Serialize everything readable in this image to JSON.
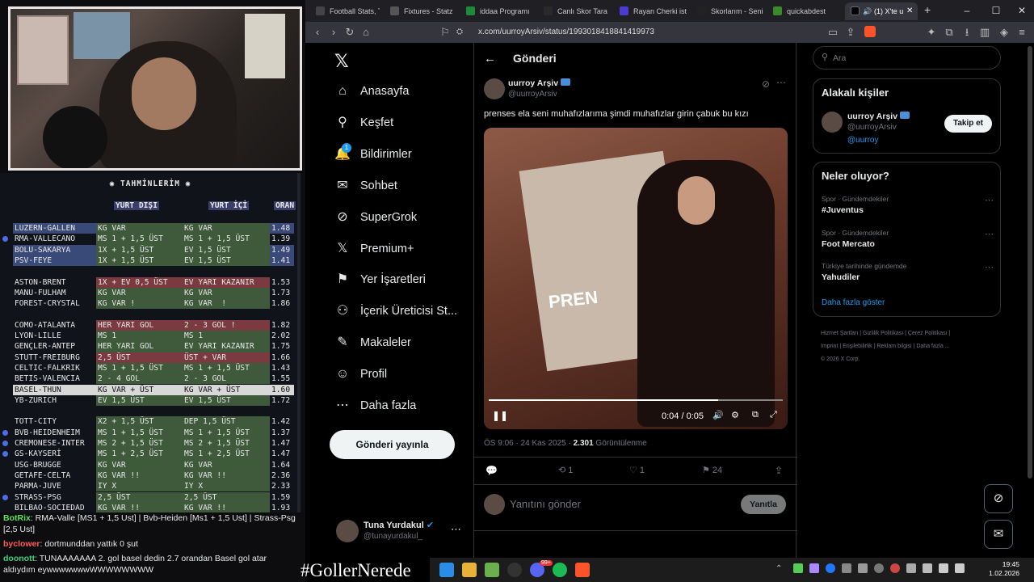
{
  "stream": {
    "table_title": "TAHMİNLERİM",
    "col_headers": {
      "away": "YURT DIŞI",
      "home": "YURT İÇİ",
      "odds": "ORAN"
    },
    "groups": [
      [
        {
          "match": "LUZERN-GALLEN",
          "a": "KG VAR",
          "b": "KG VAR",
          "o": "1.48",
          "ca": "g",
          "cb": "g",
          "cm": "b",
          "dot": false
        },
        {
          "match": "RMA-VALLECANO",
          "a": "MS 1 + 1,5 ÜST",
          "b": "MS 1 + 1,5 ÜST",
          "o": "1.39",
          "ca": "g",
          "cb": "g",
          "cm": "n",
          "dot": true
        },
        {
          "match": "BOLU-SAKARYA",
          "a": "1X + 1,5 ÜST",
          "b": "EV 1,5 ÜST",
          "o": "1.49",
          "ca": "g",
          "cb": "g",
          "cm": "b",
          "dot": false
        },
        {
          "match": "PSV-FEYE",
          "a": "1X + 1,5 ÜST",
          "b": "EV 1,5 ÜST",
          "o": "1.41",
          "ca": "g",
          "cb": "g",
          "cm": "b",
          "dot": false
        }
      ],
      [
        {
          "match": "ASTON-BRENT",
          "a": "1X + EV 0,5 ÜST",
          "b": "EV YARI KAZANIR",
          "o": "1.53",
          "ca": "r",
          "cb": "r",
          "cm": "n",
          "dot": false
        },
        {
          "match": "MANU-FULHAM",
          "a": "KG VAR",
          "b": "KG VAR",
          "o": "1.73",
          "ca": "g",
          "cb": "g",
          "cm": "n",
          "dot": false
        },
        {
          "match": "FOREST-CRYSTAL",
          "a": "KG VAR !",
          "b": "KG VAR  !",
          "o": "1.86",
          "ca": "g",
          "cb": "g",
          "cm": "n",
          "dot": false
        }
      ],
      [
        {
          "match": "COMO-ATALANTA",
          "a": "HER YARI GOL",
          "b": "2 - 3 GOL !",
          "o": "1.82",
          "ca": "r",
          "cb": "r",
          "cm": "n",
          "dot": false
        },
        {
          "match": "LYON-LILLE",
          "a": "MS 1",
          "b": "MS 1",
          "o": "2.02",
          "ca": "g",
          "cb": "g",
          "cm": "n",
          "dot": false
        },
        {
          "match": "GENÇLER-ANTEP",
          "a": "HER YARI GOL",
          "b": "EV YARI KAZANIR",
          "o": "1.75",
          "ca": "g",
          "cb": "g",
          "cm": "n",
          "dot": false
        },
        {
          "match": "STUTT-FREIBURG",
          "a": "2,5 ÜST",
          "b": "ÜST + VAR",
          "o": "1.66",
          "ca": "r",
          "cb": "r",
          "cm": "n",
          "dot": false
        },
        {
          "match": "CELTIC-FALKRIK",
          "a": "MS 1 + 1,5 ÜST",
          "b": "MS 1 + 1,5 ÜST",
          "o": "1.43",
          "ca": "g",
          "cb": "g",
          "cm": "n",
          "dot": false
        },
        {
          "match": "BETIS-VALENCIA",
          "a": "2 - 4 GOL",
          "b": "2 - 3 GOL",
          "o": "1.55",
          "ca": "g",
          "cb": "g",
          "cm": "n",
          "dot": false
        },
        {
          "match": "BASEL-THUN",
          "a": "KG VAR + ÜST",
          "b": "KG VAR + ÜST",
          "o": "1.60",
          "ca": "w",
          "cb": "w",
          "cm": "w",
          "dot": false
        },
        {
          "match": "YB-ZURICH",
          "a": "EV 1,5 ÜST",
          "b": "EV 1,5 ÜST",
          "o": "1.72",
          "ca": "g",
          "cb": "g",
          "cm": "n",
          "dot": false
        }
      ],
      [
        {
          "match": "TOTT-CITY",
          "a": "X2 + 1,5 ÜST",
          "b": "DEP 1,5 ÜST",
          "o": "1.42",
          "ca": "g",
          "cb": "g",
          "cm": "n",
          "dot": false
        },
        {
          "match": "BVB-HEIDENHEIM",
          "a": "MS 1 + 1,5 ÜST",
          "b": "MS 1 + 1,5 ÜST",
          "o": "1.37",
          "ca": "g",
          "cb": "g",
          "cm": "n",
          "dot": true
        },
        {
          "match": "CREMONESE-INTER",
          "a": "MS 2 + 1,5 ÜST",
          "b": "MS 2 + 1,5 ÜST",
          "o": "1.47",
          "ca": "g",
          "cb": "g",
          "cm": "n",
          "dot": true
        },
        {
          "match": "GS-KAYSERİ",
          "a": "MS 1 + 2,5 ÜST",
          "b": "MS 1 + 2,5 ÜST",
          "o": "1.47",
          "ca": "g",
          "cb": "g",
          "cm": "n",
          "dot": true
        },
        {
          "match": "USG-BRUGGE",
          "a": "KG VAR",
          "b": "KG VAR",
          "o": "1.64",
          "ca": "g",
          "cb": "g",
          "cm": "n",
          "dot": false
        },
        {
          "match": "GETAFE-CELTA",
          "a": "KG VAR !!",
          "b": "KG VAR !!",
          "o": "2.36",
          "ca": "g",
          "cb": "g",
          "cm": "n",
          "dot": false
        },
        {
          "match": "PARMA-JUVE",
          "a": "IY X",
          "b": "IY X",
          "o": "2.33",
          "ca": "g",
          "cb": "g",
          "cm": "n",
          "dot": false
        },
        {
          "match": "STRASS-PSG",
          "a": "2,5 ÜST",
          "b": "2,5 ÜST",
          "o": "1.59",
          "ca": "g",
          "cb": "g",
          "cm": "n",
          "dot": true
        },
        {
          "match": "BILBAO-SOCIEDAD",
          "a": "KG VAR !!",
          "b": "KG VAR !!",
          "o": "1.93",
          "ca": "g",
          "cb": "g",
          "cm": "n",
          "dot": false
        }
      ]
    ],
    "chat": [
      {
        "user": "BotRix",
        "user_color": "#5be35b",
        "text": ": RMA-Valle [MS1 + 1,5 Ust] | Bvb-Heiden [Ms1 + 1,5 Ust] | Strass-Psg [2,5 Ust]"
      },
      {
        "user": "byclower",
        "user_color": "#ff5a5a",
        "text": ": dortmunddan yattık 0 şut"
      },
      {
        "user": "doonott",
        "user_color": "#3fd17a",
        "text": ": TUNAAAAAAA 2. gol basel dedin 2.7 orandan Basel gol atar aldıydım eywwwwwwwWWWWWWWW"
      }
    ],
    "hashtag": "#GollerNerede"
  },
  "browser": {
    "tabs": [
      {
        "label": "Football Stats, Tal",
        "color": "#444"
      },
      {
        "label": "Fixtures - Statz",
        "color": "#555"
      },
      {
        "label": "iddaa Programı -",
        "color": "#1b8a3a"
      },
      {
        "label": "Canlı Skor Tarayıc",
        "color": "#2a2a2a"
      },
      {
        "label": "Rayan Cherki istat",
        "color": "#4b3bd1"
      },
      {
        "label": "Skorlarım - Senin",
        "color": "#222"
      },
      {
        "label": "quickabdest",
        "color": "#3b8a2a"
      },
      {
        "label": "(1) X'te u",
        "color": "#000"
      }
    ],
    "url": "x.com/uurroyArsiv/status/1993018418841419973"
  },
  "x": {
    "nav": [
      {
        "label": "Anasayfa",
        "icon": "home-icon",
        "glyph": "⌂"
      },
      {
        "label": "Keşfet",
        "icon": "search-icon",
        "glyph": "⚲"
      },
      {
        "label": "Bildirimler",
        "icon": "bell-icon",
        "glyph": "🔔"
      },
      {
        "label": "Sohbet",
        "icon": "mail-icon",
        "glyph": "✉"
      },
      {
        "label": "SuperGrok",
        "icon": "grok-icon",
        "glyph": "⊘"
      },
      {
        "label": "Premium+",
        "icon": "x-logo-icon",
        "glyph": "𝕏"
      },
      {
        "label": "Yer İşaretleri",
        "icon": "bookmark-icon",
        "glyph": "⚑"
      },
      {
        "label": "İçerik Üreticisi St...",
        "icon": "creator-icon",
        "glyph": "⚇"
      },
      {
        "label": "Makaleler",
        "icon": "article-icon",
        "glyph": "✎"
      },
      {
        "label": "Profil",
        "icon": "profile-icon",
        "glyph": "☺"
      },
      {
        "label": "Daha fazla",
        "icon": "more-icon",
        "glyph": "⋯"
      }
    ],
    "notif_badge": "1",
    "post_button": "Gönderi yayınla",
    "me": {
      "name": "Tuna Yurdakul",
      "handle": "@tunayurdakul_"
    },
    "header_title": "Gönderi",
    "post": {
      "author": "uurroy Arşiv",
      "handle": "@uurroyArsiv",
      "text": "prenses ela seni muhafızlarıma şimdi muhafızlar girin çabuk bu kızı",
      "video_time": "0:04 / 0:05",
      "video_progress": 0.78,
      "video_sign_text": "PREN",
      "time": "ÖS 9:06 · 24 Kas 2025 · ",
      "views": "2.301",
      "views_label": " Görüntülenme",
      "replies": "",
      "reposts": "1",
      "likes": "1",
      "bookmarks": "24"
    },
    "reply_placeholder": "Yanıtını gönder",
    "reply_button": "Yanıtla",
    "search_placeholder": "Ara",
    "related_title": "Alakalı kişiler",
    "related": {
      "name": "uurroy Arşiv",
      "handle": "@uurroyArsiv",
      "link": "@uurroy",
      "follow": "Takip et"
    },
    "trends_title": "Neler oluyor?",
    "trends": [
      {
        "cat": "Spor · Gündemdekiler",
        "name": "#Juventus"
      },
      {
        "cat": "Spor · Gündemdekiler",
        "name": "Foot Mercato"
      },
      {
        "cat": "Türkiye tarihinde gündemde",
        "name": "Yahudiler"
      }
    ],
    "show_more": "Daha fazla göster",
    "footer": [
      "Hizmet Şartları",
      "Gizlilik Politikası",
      "Çerez Politikası",
      "Imprint",
      "Erişilebilirlik",
      "Reklam bilgisi",
      "Daha fazla ...",
      "© 2026 X Corp."
    ]
  },
  "taskbar": {
    "time": "19:45",
    "date": "1.02.2026",
    "spotify_badge": "99+"
  }
}
